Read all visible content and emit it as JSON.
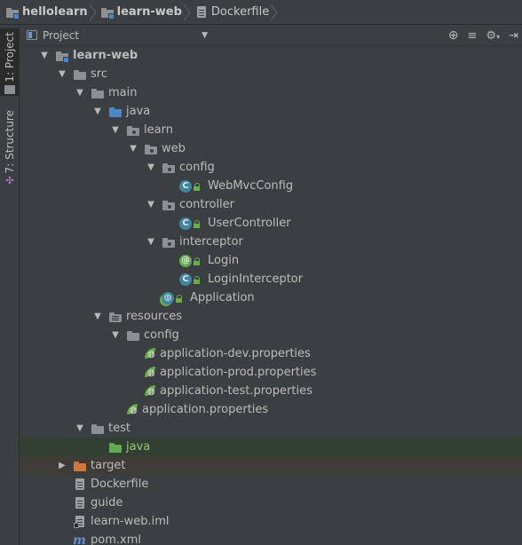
{
  "breadcrumb": {
    "items": [
      {
        "label": "hellolearn"
      },
      {
        "label": "learn-web"
      },
      {
        "label": "Dockerfile"
      }
    ]
  },
  "stripe": {
    "project_tab": "1: Project",
    "structure_tab": "7: Structure"
  },
  "panel": {
    "title": "Project"
  },
  "tree": [
    {
      "label": "learn-web",
      "icon": "module-icon",
      "depth": 0,
      "arrow": "▼",
      "bold": true
    },
    {
      "label": "src",
      "icon": "folder-icon",
      "depth": 1,
      "arrow": "▼"
    },
    {
      "label": "main",
      "icon": "folder-icon",
      "depth": 2,
      "arrow": "▼"
    },
    {
      "label": "java",
      "icon": "source-folder-icon",
      "depth": 3,
      "arrow": "▼"
    },
    {
      "label": "learn",
      "icon": "package-icon",
      "depth": 4,
      "arrow": "▼"
    },
    {
      "label": "web",
      "icon": "package-icon",
      "depth": 5,
      "arrow": "▼"
    },
    {
      "label": "config",
      "icon": "package-icon",
      "depth": 6,
      "arrow": "▼"
    },
    {
      "label": "WebMvcConfig",
      "icon": "class-icon",
      "depth": 7,
      "arrow": ""
    },
    {
      "label": "controller",
      "icon": "package-icon",
      "depth": 6,
      "arrow": "▼"
    },
    {
      "label": "UserController",
      "icon": "class-icon",
      "depth": 7,
      "arrow": ""
    },
    {
      "label": "interceptor",
      "icon": "package-icon",
      "depth": 6,
      "arrow": "▼"
    },
    {
      "label": "Login",
      "icon": "annotation-icon",
      "depth": 7,
      "arrow": ""
    },
    {
      "label": "LoginInterceptor",
      "icon": "class-icon",
      "depth": 7,
      "arrow": ""
    },
    {
      "label": "Application",
      "icon": "spring-class-icon",
      "depth": 6,
      "arrow": ""
    },
    {
      "label": "resources",
      "icon": "resources-folder-icon",
      "depth": 3,
      "arrow": "▼"
    },
    {
      "label": "config",
      "icon": "folder-icon",
      "depth": 4,
      "arrow": "▼"
    },
    {
      "label": "application-dev.properties",
      "icon": "spring-properties-icon",
      "depth": 5,
      "arrow": ""
    },
    {
      "label": "application-prod.properties",
      "icon": "spring-properties-icon",
      "depth": 5,
      "arrow": ""
    },
    {
      "label": "application-test.properties",
      "icon": "spring-properties-icon",
      "depth": 5,
      "arrow": ""
    },
    {
      "label": "application.properties",
      "icon": "spring-properties-icon",
      "depth": 4,
      "arrow": ""
    },
    {
      "label": "test",
      "icon": "folder-icon",
      "depth": 2,
      "arrow": "▼"
    },
    {
      "label": "java",
      "icon": "test-folder-icon",
      "depth": 3,
      "arrow": "",
      "green": true,
      "state": "selected"
    },
    {
      "label": "target",
      "icon": "excluded-folder-icon",
      "depth": 1,
      "arrow": "▶",
      "state": "highlight"
    },
    {
      "label": "Dockerfile",
      "icon": "file-icon",
      "depth": 1,
      "arrow": ""
    },
    {
      "label": "guide",
      "icon": "file-icon",
      "depth": 1,
      "arrow": ""
    },
    {
      "label": "learn-web.iml",
      "icon": "iml-file-icon",
      "depth": 1,
      "arrow": ""
    },
    {
      "label": "pom.xml",
      "icon": "maven-icon",
      "depth": 1,
      "arrow": ""
    }
  ]
}
